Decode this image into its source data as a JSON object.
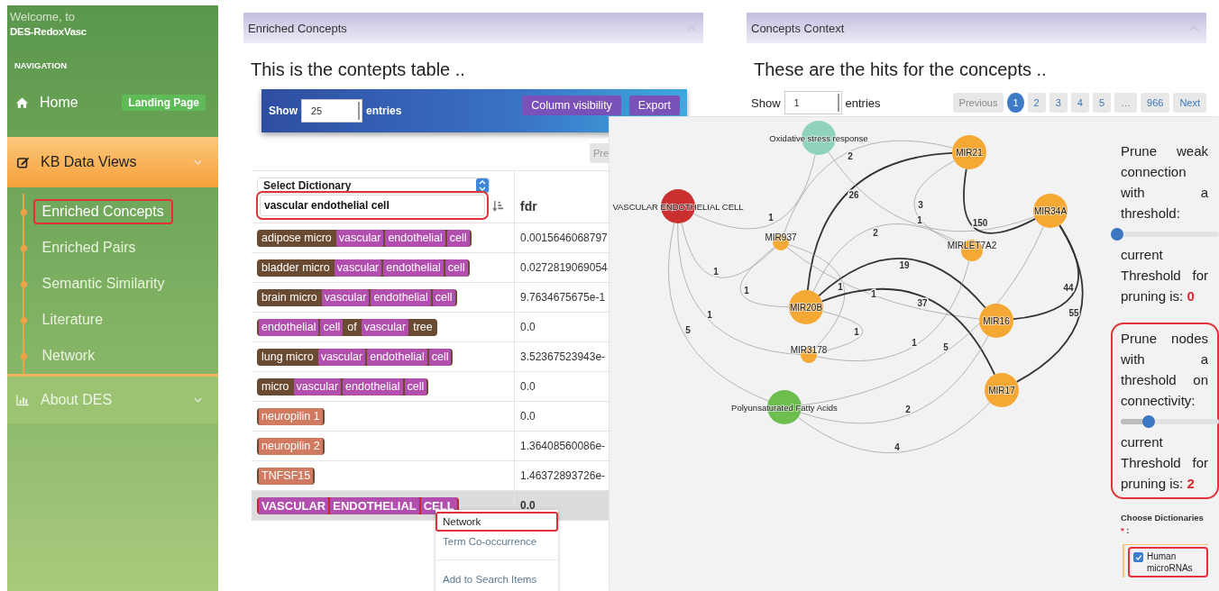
{
  "sidebar": {
    "welcome": "Welcome, to",
    "app_name": "DES-RedoxVasc",
    "section_title": "NAVIGATION",
    "items": [
      {
        "kind": "link",
        "label": "Home",
        "badge": "Landing Page"
      },
      {
        "kind": "group",
        "label": "KB Data Views",
        "expanded": true,
        "children": [
          {
            "label": "Enriched Concepts",
            "highlighted": true
          },
          {
            "label": "Enriched Pairs",
            "highlighted": false
          },
          {
            "label": "Semantic Similarity",
            "highlighted": false
          },
          {
            "label": "Literature",
            "highlighted": false
          },
          {
            "label": "Network",
            "highlighted": false
          }
        ]
      },
      {
        "kind": "group",
        "label": "About DES",
        "expanded": false
      }
    ]
  },
  "concepts_panel": {
    "title": "Enriched Concepts",
    "heading": "This is the contepts table ..",
    "length_menu": {
      "show": "Show",
      "value": "25",
      "entries": "entries"
    },
    "buttons": [
      "Column visibility",
      "Export"
    ],
    "pager_button": "Pre",
    "table": {
      "dictionary_select": "Select Dictionary",
      "search": {
        "value": "vascular endothelial cell",
        "highlighted": true
      },
      "columns": [
        "fdr"
      ],
      "rows": [
        {
          "selected": false,
          "term": [
            {
              "text": "adipose micro",
              "kind": "other"
            },
            {
              "text": "vascular",
              "kind": "match"
            },
            {
              "text": "endothelial",
              "kind": "match"
            },
            {
              "text": "cell",
              "kind": "match"
            }
          ],
          "fdr": "0.0015646068797"
        },
        {
          "selected": false,
          "term": [
            {
              "text": "bladder micro",
              "kind": "other"
            },
            {
              "text": "vascular",
              "kind": "match"
            },
            {
              "text": "endothelial",
              "kind": "match"
            },
            {
              "text": "cell",
              "kind": "match"
            }
          ],
          "fdr": "0.0272819069054"
        },
        {
          "selected": false,
          "term": [
            {
              "text": "brain micro",
              "kind": "other"
            },
            {
              "text": "vascular",
              "kind": "match"
            },
            {
              "text": "endothelial",
              "kind": "match"
            },
            {
              "text": "cell",
              "kind": "match"
            }
          ],
          "fdr": "9.7634675675e-1"
        },
        {
          "selected": false,
          "term": [
            {
              "text": "endothelial",
              "kind": "match"
            },
            {
              "text": "cell",
              "kind": "match"
            },
            {
              "text": "of",
              "kind": "other"
            },
            {
              "text": "vascular",
              "kind": "match"
            },
            {
              "text": "tree",
              "kind": "other"
            }
          ],
          "fdr": "0.0"
        },
        {
          "selected": false,
          "term": [
            {
              "text": "lung micro",
              "kind": "other"
            },
            {
              "text": "vascular",
              "kind": "match"
            },
            {
              "text": "endothelial",
              "kind": "match"
            },
            {
              "text": "cell",
              "kind": "match"
            }
          ],
          "fdr": "3.52367523943e-"
        },
        {
          "selected": false,
          "term": [
            {
              "text": "micro",
              "kind": "other"
            },
            {
              "text": "vascular",
              "kind": "match"
            },
            {
              "text": "endothelial",
              "kind": "match"
            },
            {
              "text": "cell",
              "kind": "match"
            }
          ],
          "fdr": "0.0"
        },
        {
          "selected": false,
          "term": [
            {
              "text": "neuropilin 1",
              "kind": "gene"
            }
          ],
          "fdr": "0.0"
        },
        {
          "selected": false,
          "term": [
            {
              "text": "neuropilin 2",
              "kind": "gene"
            }
          ],
          "fdr": "1.36408560086e-"
        },
        {
          "selected": false,
          "term": [
            {
              "text": "TNFSF15",
              "kind": "gene"
            }
          ],
          "fdr": "1.46372893726e-"
        },
        {
          "selected": true,
          "term": [
            {
              "text": "VASCULAR",
              "kind": "match"
            },
            {
              "text": "ENDOTHELIAL",
              "kind": "match"
            },
            {
              "text": "CELL",
              "kind": "match"
            }
          ],
          "fdr": "0.0"
        }
      ]
    },
    "context_menu": [
      {
        "label": "Network",
        "highlighted": true
      },
      {
        "label": "Term Co-occurrence",
        "highlighted": false
      },
      {
        "label": "Add to Search Items",
        "highlighted": false
      }
    ]
  },
  "context_panel": {
    "title": "Concepts Context",
    "heading": "These are the hits for the concepts ..",
    "length_menu": {
      "show": "Show",
      "value": "1",
      "entries": "entries"
    },
    "pagination": [
      {
        "label": "Previous",
        "selected": false,
        "disabled": true
      },
      {
        "label": "1",
        "selected": true,
        "disabled": false
      },
      {
        "label": "2",
        "selected": false,
        "disabled": false
      },
      {
        "label": "3",
        "selected": false,
        "disabled": false
      },
      {
        "label": "4",
        "selected": false,
        "disabled": false
      },
      {
        "label": "5",
        "selected": false,
        "disabled": false
      },
      {
        "label": "…",
        "selected": false,
        "disabled": true
      },
      {
        "label": "966",
        "selected": false,
        "disabled": false
      },
      {
        "label": "Next",
        "selected": false,
        "disabled": false
      }
    ]
  },
  "network": {
    "nodes": [
      {
        "label": "Oxidative stress response",
        "color": "#8fd3bf"
      },
      {
        "label": "MIR21",
        "color": "#f5a833"
      },
      {
        "label": "VASCULAR ENDOTHELIAL CELL",
        "color": "#c9302f"
      },
      {
        "label": "MIR34A",
        "color": "#f5a833"
      },
      {
        "label": "MIR937",
        "color": "#f5a833"
      },
      {
        "label": "MIRLET7A2",
        "color": "#f5a833"
      },
      {
        "label": "MIR20B",
        "color": "#f5a833"
      },
      {
        "label": "MIR16",
        "color": "#f5a833"
      },
      {
        "label": "MIR3178",
        "color": "#f5a833"
      },
      {
        "label": "MIR17",
        "color": "#f5a833"
      },
      {
        "label": "Polyunsaturated Fatty Acids",
        "color": "#6cbf4e"
      }
    ],
    "edges": [
      {
        "label": "2"
      },
      {
        "label": "26"
      },
      {
        "label": "3"
      },
      {
        "label": "1"
      },
      {
        "label": "1"
      },
      {
        "label": "150"
      },
      {
        "label": "2"
      },
      {
        "label": "1"
      },
      {
        "label": "19"
      },
      {
        "label": "1"
      },
      {
        "label": "1"
      },
      {
        "label": "1"
      },
      {
        "label": "44"
      },
      {
        "label": "37"
      },
      {
        "label": "1"
      },
      {
        "label": "55"
      },
      {
        "label": "5"
      },
      {
        "label": "1"
      },
      {
        "label": "1"
      },
      {
        "label": "5"
      },
      {
        "label": "2"
      },
      {
        "label": "4"
      }
    ],
    "controls": {
      "pruners": [
        {
          "label": "Prune weak connection with a threshold:",
          "level": 0,
          "current_label": "current Threshold for pruning is:",
          "current_value": "0",
          "highlighted": false
        },
        {
          "label": "Prune nodes with a threshold on connectivity:",
          "level": 0.25,
          "current_label": "current Threshold for pruning is:",
          "current_value": "2",
          "highlighted": true
        }
      ],
      "dictionaries": {
        "label": "Choose Dictionaries",
        "required_mark": "*",
        "suffix": ":",
        "options": [
          {
            "label": "Human microRNAs",
            "checked": true,
            "highlighted": true
          }
        ]
      }
    }
  }
}
